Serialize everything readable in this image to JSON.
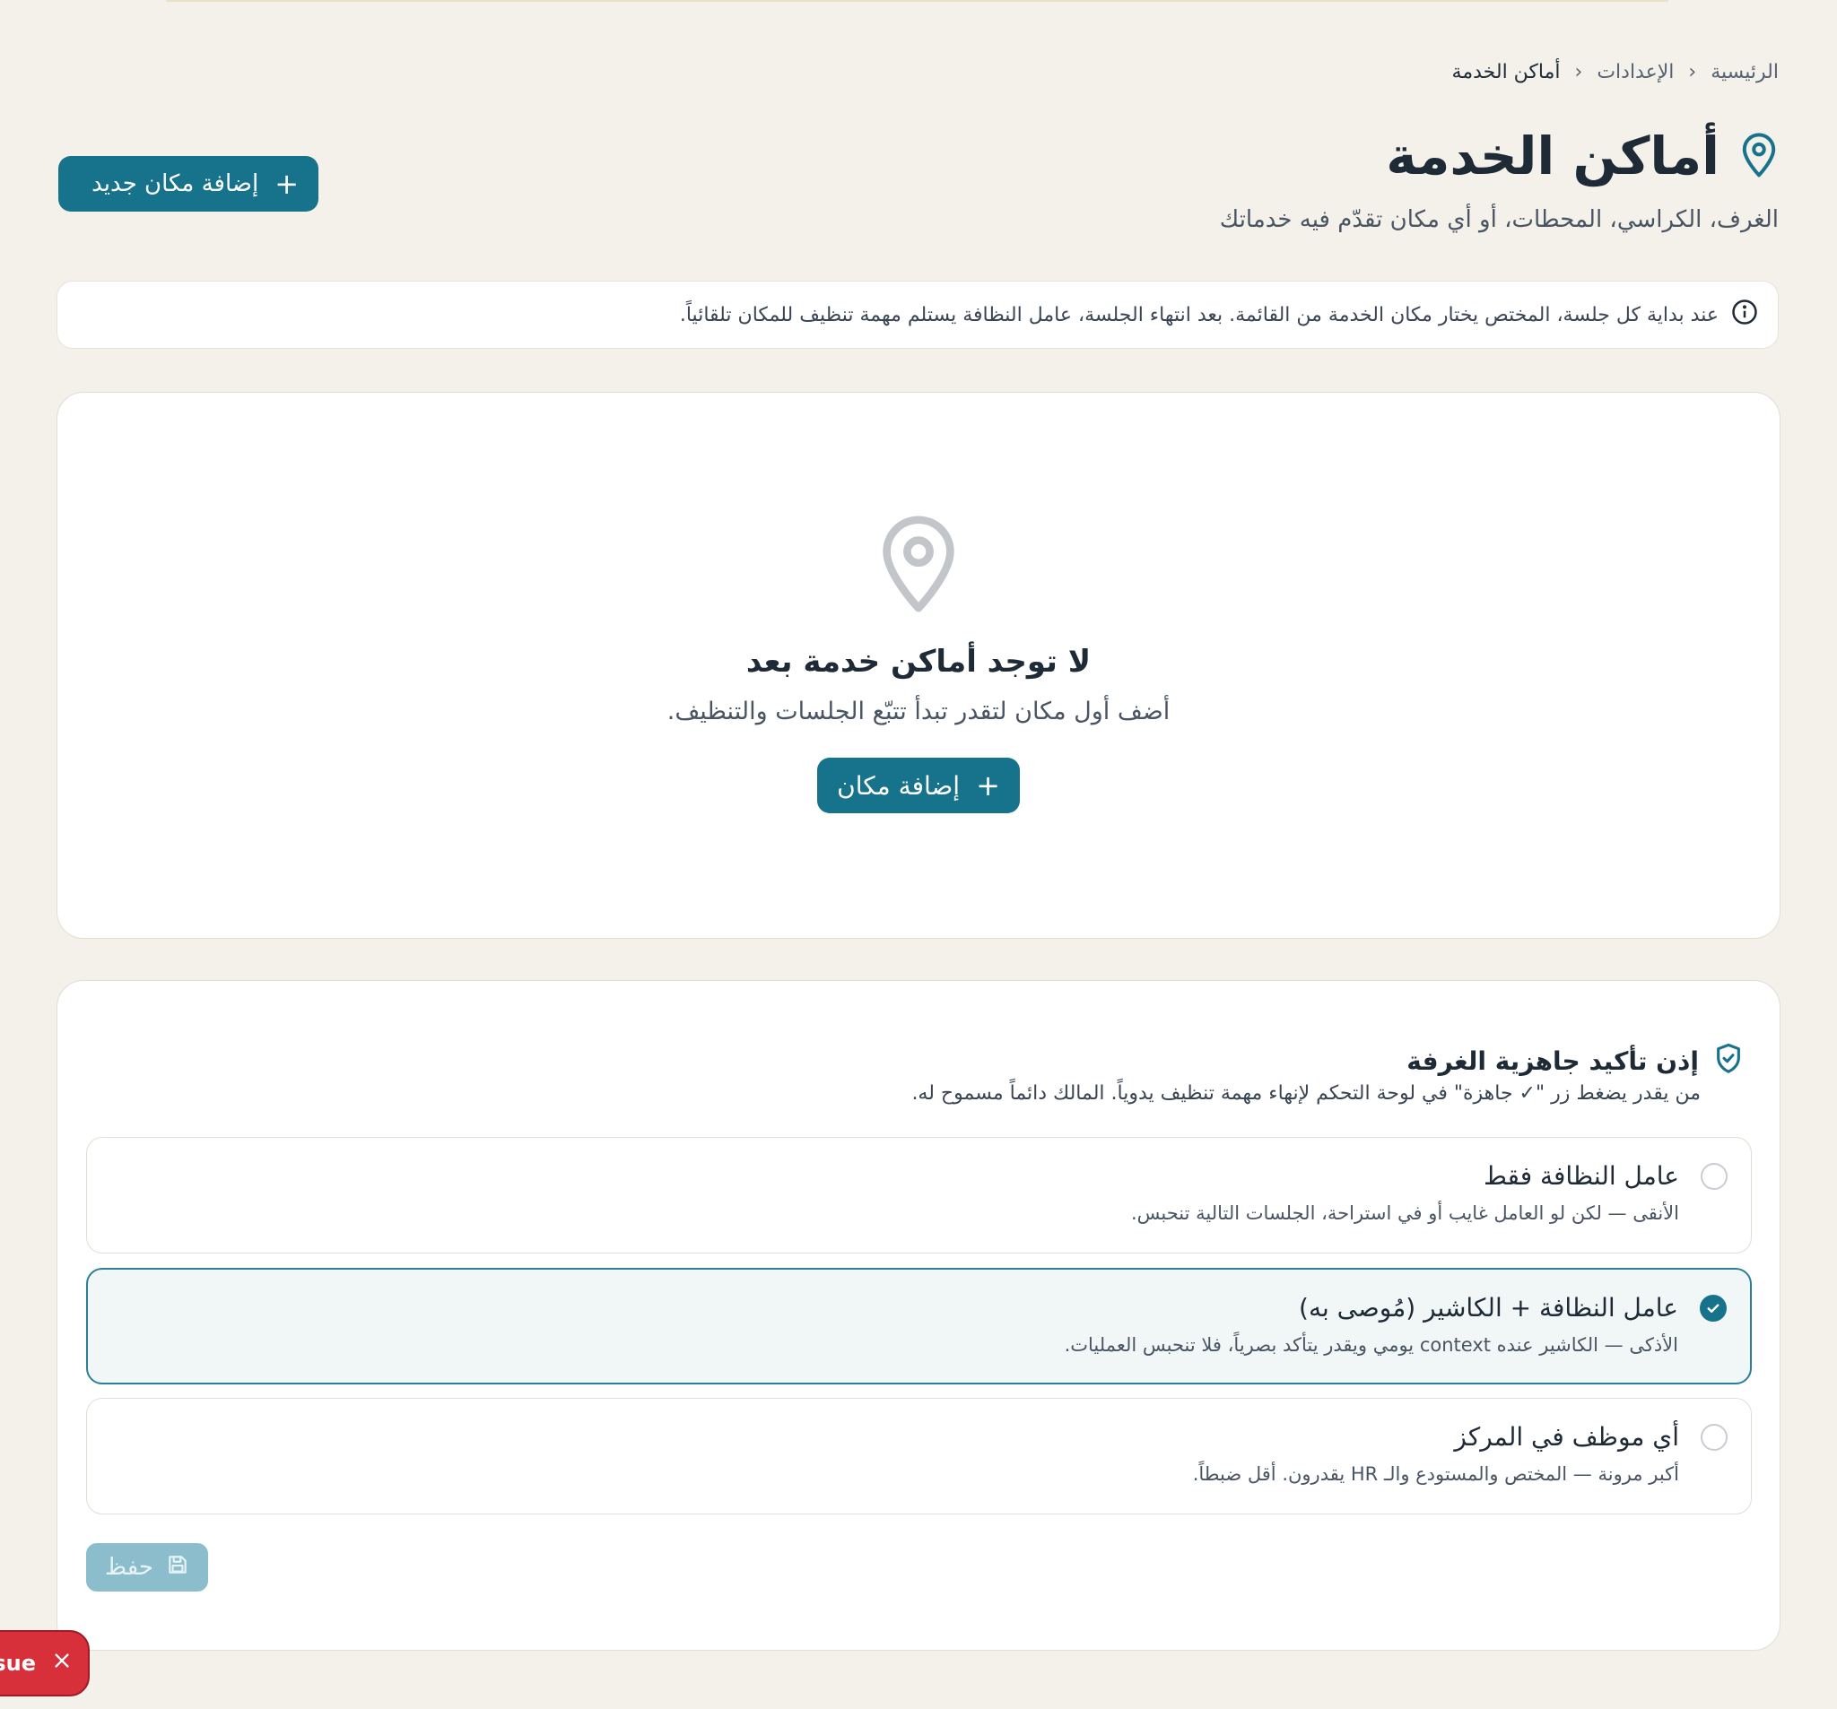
{
  "breadcrumb": {
    "home": "الرئيسية",
    "settings": "الإعدادات",
    "current": "أماكن الخدمة"
  },
  "page": {
    "title": "أماكن الخدمة",
    "subtitle": "الغرف، الكراسي، المحطات، أو أي مكان تقدّم فيه خدماتك",
    "add_button": "إضافة مكان جديد"
  },
  "info": {
    "text": "عند بداية كل جلسة، المختص يختار مكان الخدمة من القائمة. بعد انتهاء الجلسة، عامل النظافة يستلم مهمة تنظيف للمكان تلقائياً."
  },
  "empty_state": {
    "title": "لا توجد أماكن خدمة بعد",
    "subtitle": "أضف أول مكان لتقدر تبدأ تتبّع الجلسات والتنظيف.",
    "button": "إضافة مكان"
  },
  "permission": {
    "title": "إذن تأكيد جاهزية الغرفة",
    "description": "من يقدر يضغط زر \"✓ جاهزة\" في لوحة التحكم لإنهاء مهمة تنظيف يدوياً. المالك دائماً مسموح له.",
    "options": [
      {
        "label": "عامل النظافة فقط",
        "desc": "الأنقى — لكن لو العامل غايب أو في استراحة، الجلسات التالية تنحبس.",
        "selected": false
      },
      {
        "label": "عامل النظافة + الكاشير (مُوصى به)",
        "desc": "الأذكى — الكاشير عنده context يومي ويقدر يتأكد بصرياً، فلا تنحبس العمليات.",
        "selected": true
      },
      {
        "label": "أي موظف في المركز",
        "desc": "أكبر مرونة — المختص والمستودع والـ HR يقدرون. أقل ضبطاً.",
        "selected": false
      }
    ],
    "save_button": "حفظ"
  },
  "issue_button": {
    "label": "sue"
  },
  "colors": {
    "primary": "#17728c",
    "background": "#f4f1ea",
    "danger": "#d7303a"
  }
}
